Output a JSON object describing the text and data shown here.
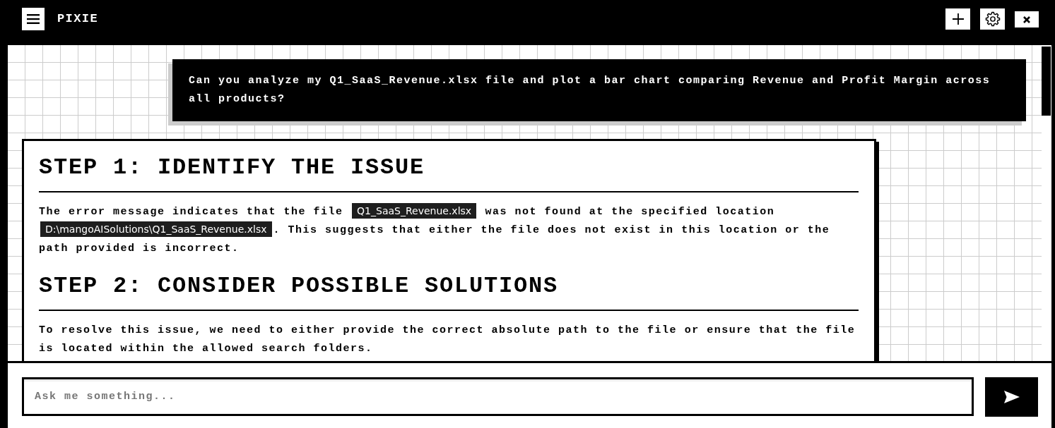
{
  "header": {
    "title": "PIXIE"
  },
  "conversation": {
    "messages": [
      {
        "kind": "user",
        "text": "Can you analyze my Q1_SaaS_Revenue.xlsx file and plot a bar chart comparing Revenue and Profit Margin across all products?"
      },
      {
        "kind": "assistant",
        "blocks": [
          {
            "kind": "heading",
            "text": "STEP 1: IDENTIFY THE ISSUE"
          },
          {
            "kind": "paragraph",
            "segments": [
              {
                "kind": "text",
                "text": "The error message indicates that the file "
              },
              {
                "kind": "code",
                "text": "Q1_SaaS_Revenue.xlsx"
              },
              {
                "kind": "text",
                "text": " was not found at the specified location "
              },
              {
                "kind": "code",
                "text": "D:\\mangoAISolutions\\Q1_SaaS_Revenue.xlsx"
              },
              {
                "kind": "text",
                "text": ". This suggests that either the file does not exist in this location or the "
              },
              {
                "kind": "text",
                "text": "path provided is incorrect."
              }
            ]
          },
          {
            "kind": "heading",
            "text": "STEP 2: CONSIDER POSSIBLE SOLUTIONS"
          },
          {
            "kind": "paragraph",
            "segments": [
              {
                "kind": "text",
                "text": "To resolve this issue, we need to either provide the correct absolute path to the file or ensure that the file is located within the allowed search folders."
              }
            ]
          }
        ]
      }
    ]
  },
  "composer": {
    "placeholder": "Ask me something..."
  }
}
